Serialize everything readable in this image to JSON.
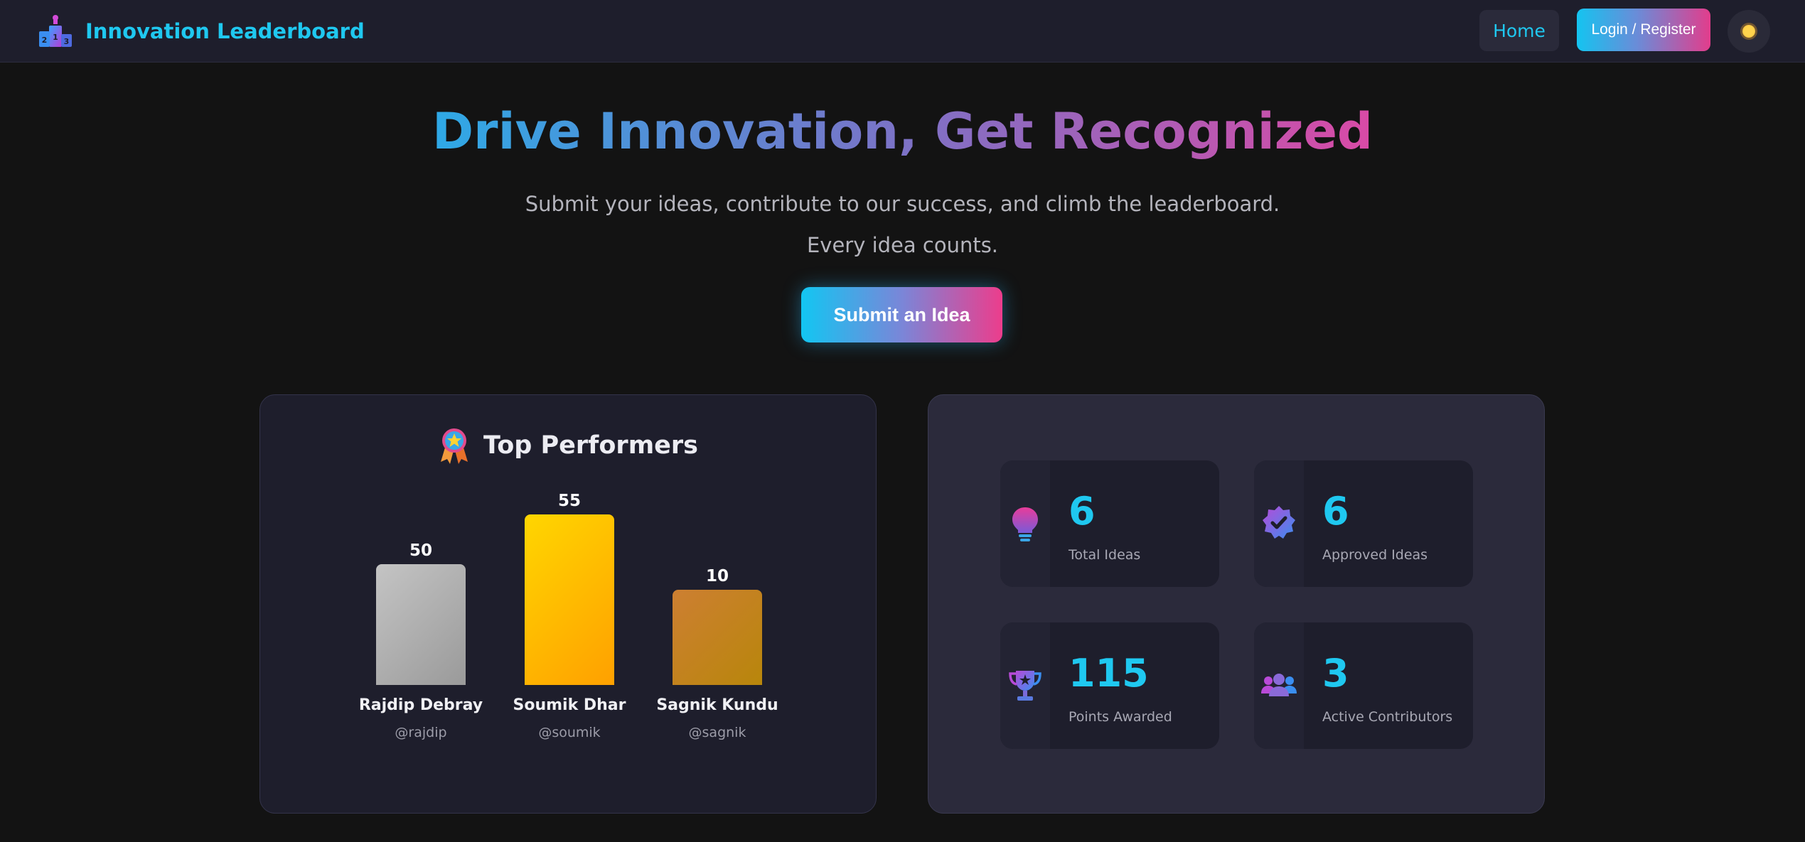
{
  "navbar": {
    "brand": "Innovation Leaderboard",
    "brand_icon": "podium-icon",
    "home_label": "Home",
    "login_label": "Login / Register",
    "theme_icon": "sun-icon"
  },
  "hero": {
    "title": "Drive Innovation, Get Recognized",
    "subtitle_line1": "Submit your ideas, contribute to our success, and climb the leaderboard.",
    "subtitle_line2": "Every idea counts.",
    "cta_label": "Submit an Idea"
  },
  "top_performers": {
    "title": "Top Performers",
    "icon": "medal-icon",
    "performers": [
      {
        "name": "Rajdip Debray",
        "handle": "@rajdip",
        "points": "50",
        "rank_color": "silver"
      },
      {
        "name": "Soumik Dhar",
        "handle": "@soumik",
        "points": "55",
        "rank_color": "gold"
      },
      {
        "name": "Sagnik Kundu",
        "handle": "@sagnik",
        "points": "10",
        "rank_color": "bronze"
      }
    ]
  },
  "chart_data": {
    "type": "bar",
    "categories": [
      "Rajdip Debray",
      "Soumik Dhar",
      "Sagnik Kundu"
    ],
    "values": [
      50,
      55,
      10
    ]
  },
  "stats": [
    {
      "value": "6",
      "label": "Total Ideas",
      "icon": "lightbulb-icon"
    },
    {
      "value": "6",
      "label": "Approved Ideas",
      "icon": "verified-badge-icon"
    },
    {
      "value": "115",
      "label": "Points Awarded",
      "icon": "trophy-icon"
    },
    {
      "value": "3",
      "label": "Active Contributors",
      "icon": "users-icon"
    }
  ],
  "colors": {
    "accent_cyan": "#1fc8f0",
    "accent_pink": "#ec3d8c",
    "background": "#131313",
    "card": "#1e1e2c"
  }
}
